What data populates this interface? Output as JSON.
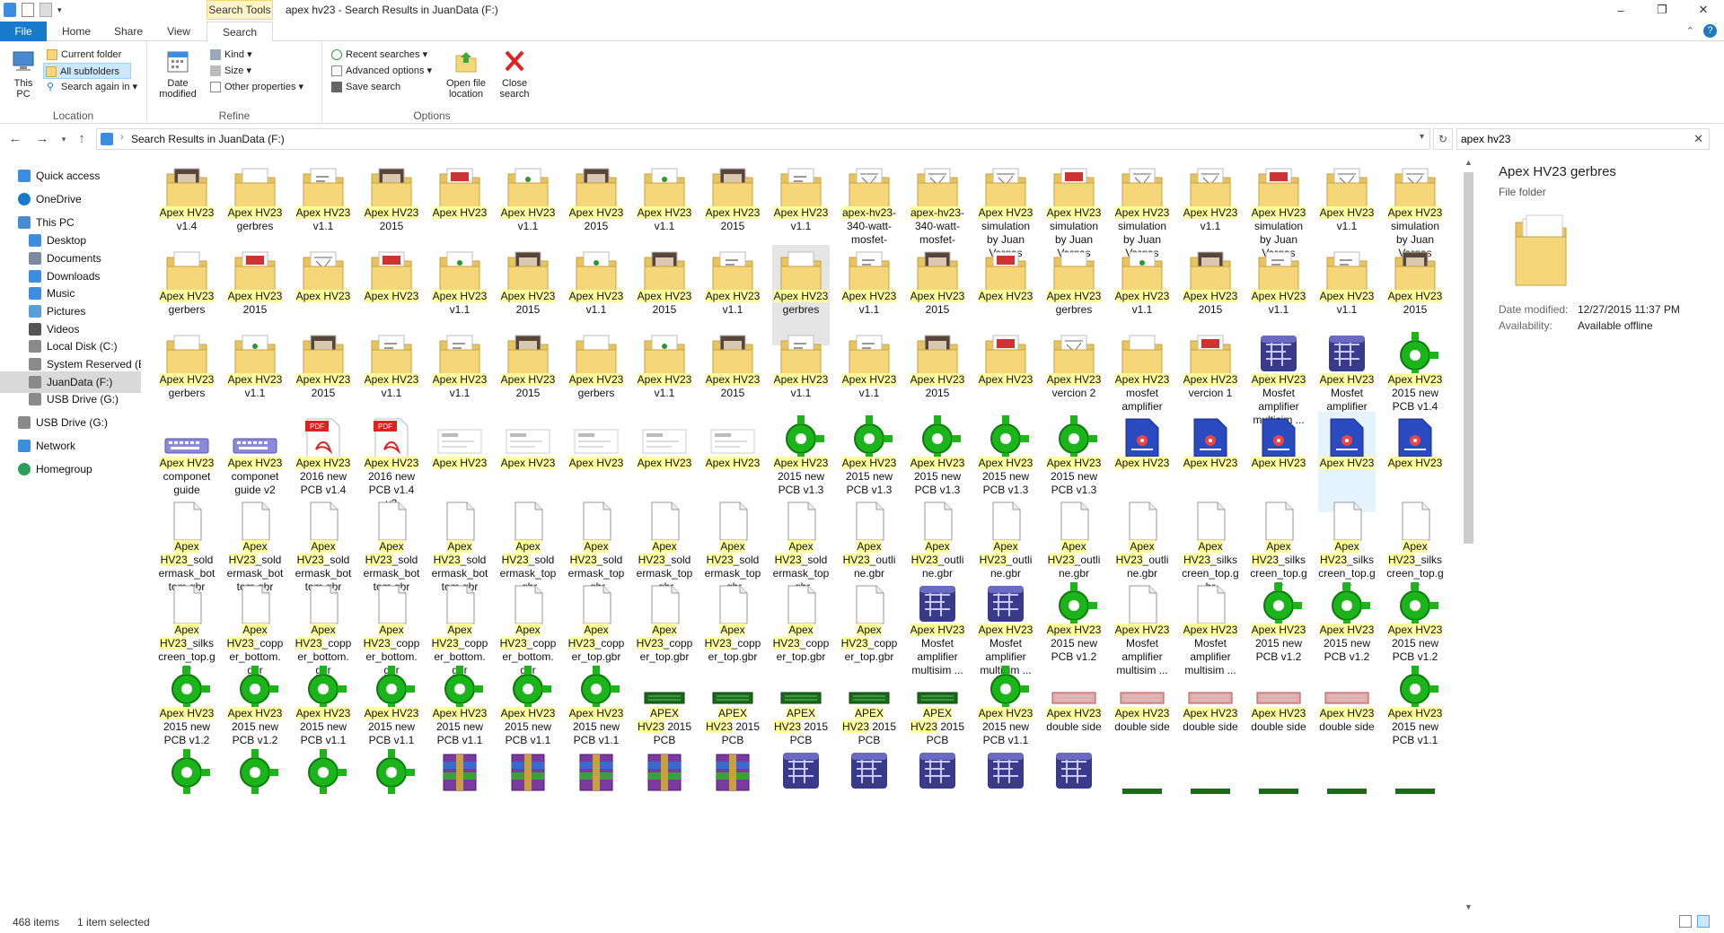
{
  "window": {
    "title": "apex hv23 - Search Results in JuanData (F:)",
    "search_tools_label": "Search Tools"
  },
  "tabs": {
    "file": "File",
    "home": "Home",
    "share": "Share",
    "view": "View",
    "search": "Search"
  },
  "ribbon": {
    "location": {
      "label": "Location",
      "this_pc": "This PC",
      "current_folder": "Current folder",
      "all_subfolders": "All subfolders",
      "search_again": "Search again in"
    },
    "refine": {
      "label": "Refine",
      "date_modified": "Date modified",
      "kind": "Kind",
      "size": "Size",
      "other_properties": "Other properties"
    },
    "options": {
      "label": "Options",
      "recent_searches": "Recent searches",
      "advanced_options": "Advanced options",
      "save_search": "Save search",
      "open_file_location": "Open file location",
      "close_search": "Close search"
    }
  },
  "address": {
    "path": "Search Results in JuanData (F:)"
  },
  "search": {
    "value": "apex hv23"
  },
  "nav": [
    {
      "label": "Quick access",
      "icon": "star-icon",
      "color": "#3d8ee0",
      "indent": 20
    },
    {
      "label": "OneDrive",
      "icon": "cloud-icon",
      "color": "#1979ca",
      "indent": 20
    },
    {
      "label": "This PC",
      "icon": "computer-icon",
      "color": "#4a8ad0",
      "indent": 20
    },
    {
      "label": "Desktop",
      "icon": "desktop-icon",
      "color": "#3d8ee0",
      "indent": 32
    },
    {
      "label": "Documents",
      "icon": "documents-icon",
      "color": "#7a8aa0",
      "indent": 32
    },
    {
      "label": "Downloads",
      "icon": "download-icon",
      "color": "#3d8ee0",
      "indent": 32
    },
    {
      "label": "Music",
      "icon": "music-icon",
      "color": "#3d8ee0",
      "indent": 32
    },
    {
      "label": "Pictures",
      "icon": "pictures-icon",
      "color": "#5aa0d8",
      "indent": 32
    },
    {
      "label": "Videos",
      "icon": "videos-icon",
      "color": "#555555",
      "indent": 32
    },
    {
      "label": "Local Disk (C:)",
      "icon": "drive-icon",
      "color": "#8a8a8a",
      "indent": 32
    },
    {
      "label": "System Reserved (E:",
      "icon": "drive-icon",
      "color": "#8a8a8a",
      "indent": 32
    },
    {
      "label": "JuanData (F:)",
      "icon": "drive-icon",
      "color": "#8a8a8a",
      "indent": 32
    },
    {
      "label": "USB Drive (G:)",
      "icon": "usb-drive-icon",
      "color": "#8a8a8a",
      "indent": 32
    },
    {
      "label": "USB Drive (G:)",
      "icon": "usb-drive-icon",
      "color": "#8a8a8a",
      "indent": 20
    },
    {
      "label": "Network",
      "icon": "network-icon",
      "color": "#3d8ee0",
      "indent": 20
    },
    {
      "label": "Homegroup",
      "icon": "homegroup-icon",
      "color": "#2aa05a",
      "indent": 20
    }
  ],
  "items": [
    [
      {
        "icon": "folder-dark",
        "hl": "Apex HV23",
        "rest": " v1.4"
      },
      {
        "icon": "folder",
        "hl": "Apex HV23",
        "rest": " gerbres"
      },
      {
        "icon": "folder-doc",
        "hl": "Apex HV23",
        "rest": " v1.1"
      },
      {
        "icon": "folder-dark",
        "hl": "Apex HV23",
        "rest": " 2015"
      },
      {
        "icon": "folder-pdf",
        "hl": "Apex HV23",
        "rest": ""
      },
      {
        "icon": "folder-green",
        "hl": "Apex HV23",
        "rest": " v1.1"
      },
      {
        "icon": "folder-dark",
        "hl": "Apex HV23",
        "rest": " 2015"
      },
      {
        "icon": "folder-green",
        "hl": "Apex HV23",
        "rest": " v1.1"
      },
      {
        "icon": "folder-dark",
        "hl": "Apex HV23",
        "rest": " 2015"
      },
      {
        "icon": "folder-doc",
        "hl": "Apex HV23",
        "rest": " v1.1"
      },
      {
        "icon": "folder-sketch",
        "hl": "apex-hv23",
        "rest": "-340-watt-mosfet-"
      },
      {
        "icon": "folder-sketch",
        "hl": "apex-hv23",
        "rest": "-340-watt-mosfet-"
      },
      {
        "icon": "folder-sketch",
        "hl": "Apex HV23",
        "rest": " simulation by Juan Vargas Diaz"
      },
      {
        "icon": "folder-pdf",
        "hl": "Apex HV23",
        "rest": " simulation by Juan Vargas Diaz"
      },
      {
        "icon": "folder-sketch",
        "hl": "Apex HV23",
        "rest": " simulation by Juan Vargas Diaz"
      },
      {
        "icon": "folder-sketch",
        "hl": "Apex HV23",
        "rest": " v1.1"
      },
      {
        "icon": "folder-pdf",
        "hl": "Apex HV23",
        "rest": " simulation by Juan Vargas Diaz"
      },
      {
        "icon": "folder-sketch",
        "hl": "Apex HV23",
        "rest": " v1.1"
      },
      {
        "icon": "folder-sketch",
        "hl": "Apex HV23",
        "rest": " simulation by Juan Vargas Diaz"
      }
    ],
    [
      {
        "icon": "folder",
        "hl": "Apex HV23",
        "rest": " gerbers"
      },
      {
        "icon": "folder-pdf",
        "hl": "Apex HV23",
        "rest": " 2015"
      },
      {
        "icon": "folder-sketch",
        "hl": "Apex HV23",
        "rest": ""
      },
      {
        "icon": "folder-pdf",
        "hl": "Apex HV23",
        "rest": ""
      },
      {
        "icon": "folder-green",
        "hl": "Apex HV23",
        "rest": " v1.1"
      },
      {
        "icon": "folder-dark",
        "hl": "Apex HV23",
        "rest": " 2015"
      },
      {
        "icon": "folder-green",
        "hl": "Apex HV23",
        "rest": " v1.1"
      },
      {
        "icon": "folder-dark",
        "hl": "Apex HV23",
        "rest": " 2015"
      },
      {
        "icon": "folder-doc",
        "hl": "Apex HV23",
        "rest": " v1.1"
      },
      {
        "icon": "folder",
        "hl": "Apex HV23",
        "rest": " gerbres",
        "state": "hover"
      },
      {
        "icon": "folder-doc",
        "hl": "Apex HV23",
        "rest": " v1.1"
      },
      {
        "icon": "folder-dark",
        "hl": "Apex HV23",
        "rest": " 2015"
      },
      {
        "icon": "folder-pdf",
        "hl": "Apex HV23",
        "rest": ""
      },
      {
        "icon": "folder",
        "hl": "Apex HV23",
        "rest": " gerbres"
      },
      {
        "icon": "folder-green",
        "hl": "Apex HV23",
        "rest": " v1.1"
      },
      {
        "icon": "folder-dark",
        "hl": "Apex HV23",
        "rest": " 2015"
      },
      {
        "icon": "folder-doc",
        "hl": "Apex HV23",
        "rest": " v1.1"
      },
      {
        "icon": "folder-doc",
        "hl": "Apex HV23",
        "rest": " v1.1"
      },
      {
        "icon": "folder-dark",
        "hl": "Apex HV23",
        "rest": " 2015"
      }
    ],
    [
      {
        "icon": "folder",
        "hl": "Apex HV23",
        "rest": " gerbers"
      },
      {
        "icon": "folder-green",
        "hl": "Apex HV23",
        "rest": " v1.1"
      },
      {
        "icon": "folder-dark",
        "hl": "Apex HV23",
        "rest": " 2015"
      },
      {
        "icon": "folder-doc",
        "hl": "Apex HV23",
        "rest": " v1.1"
      },
      {
        "icon": "folder-doc",
        "hl": "Apex HV23",
        "rest": " v1.1"
      },
      {
        "icon": "folder-dark",
        "hl": "Apex HV23",
        "rest": " 2015"
      },
      {
        "icon": "folder",
        "hl": "Apex HV23",
        "rest": " gerbers"
      },
      {
        "icon": "folder-green",
        "hl": "Apex HV23",
        "rest": " v1.1"
      },
      {
        "icon": "folder-dark",
        "hl": "Apex HV23",
        "rest": " 2015"
      },
      {
        "icon": "folder-doc",
        "hl": "Apex HV23",
        "rest": " v1.1"
      },
      {
        "icon": "folder-doc",
        "hl": "Apex HV23",
        "rest": " v1.1"
      },
      {
        "icon": "folder-dark",
        "hl": "Apex HV23",
        "rest": " 2015"
      },
      {
        "icon": "folder-pdf",
        "hl": "Apex HV23",
        "rest": ""
      },
      {
        "icon": "folder-sketch",
        "hl": "Apex HV23",
        "rest": " vercion 2"
      },
      {
        "icon": "folder",
        "hl": "Apex HV23",
        "rest": " mosfet amplifier"
      },
      {
        "icon": "folder-pdf",
        "hl": "Apex HV23",
        "rest": " vercion 1"
      },
      {
        "icon": "multisim",
        "hl": "Apex HV23",
        "rest": " Mosfet amplifier multisim ..."
      },
      {
        "icon": "multisim",
        "hl": "Apex HV23",
        "rest": " Mosfet amplifier multisim"
      },
      {
        "icon": "pcb-green",
        "hl": "Apex HV23",
        "rest": " 2015 new PCB v1.4"
      }
    ],
    [
      {
        "icon": "keyboard",
        "hl": "Apex HV23",
        "rest": " componet guide"
      },
      {
        "icon": "keyboard",
        "hl": "Apex HV23",
        "rest": " componet guide v2"
      },
      {
        "icon": "pdf",
        "hl": "Apex HV23",
        "rest": " 2016 new PCB v1.4"
      },
      {
        "icon": "pdf",
        "hl": "Apex HV23",
        "rest": " 2016 new PCB v1.4 v2"
      },
      {
        "icon": "image",
        "hl": "Apex HV23",
        "rest": ""
      },
      {
        "icon": "image",
        "hl": "Apex HV23",
        "rest": ""
      },
      {
        "icon": "image",
        "hl": "Apex HV23",
        "rest": ""
      },
      {
        "icon": "image",
        "hl": "Apex HV23",
        "rest": ""
      },
      {
        "icon": "image",
        "hl": "Apex HV23",
        "rest": ""
      },
      {
        "icon": "pcb-green",
        "hl": "Apex HV23",
        "rest": " 2015 new PCB v1.3"
      },
      {
        "icon": "pcb-green",
        "hl": "Apex HV23",
        "rest": " 2015 new PCB v1.3"
      },
      {
        "icon": "pcb-green",
        "hl": "Apex HV23",
        "rest": " 2015 new PCB v1.3"
      },
      {
        "icon": "pcb-green",
        "hl": "Apex HV23",
        "rest": " 2015 new PCB v1.3"
      },
      {
        "icon": "pcb-green",
        "hl": "Apex HV23",
        "rest": " 2015 new PCB v1.3"
      },
      {
        "icon": "multisim-doc",
        "hl": "Apex HV23",
        "rest": ""
      },
      {
        "icon": "multisim-doc",
        "hl": "Apex HV23",
        "rest": ""
      },
      {
        "icon": "multisim-doc",
        "hl": "Apex HV23",
        "rest": ""
      },
      {
        "icon": "multisim-doc",
        "hl": "Apex HV23",
        "rest": "",
        "state": "selected"
      },
      {
        "icon": "multisim-doc",
        "hl": "Apex HV23",
        "rest": ""
      }
    ],
    [
      {
        "icon": "blank",
        "hl": "Apex HV23",
        "rest": "_soldermask_bottom.gbr"
      },
      {
        "icon": "blank",
        "hl": "Apex HV23",
        "rest": "_soldermask_bottom.gbr"
      },
      {
        "icon": "blank",
        "hl": "Apex HV23",
        "rest": "_soldermask_bottom.gbr"
      },
      {
        "icon": "blank",
        "hl": "Apex HV23",
        "rest": "_soldermask_bottom.gbr"
      },
      {
        "icon": "blank",
        "hl": "Apex HV23",
        "rest": "_soldermask_bottom.gbr"
      },
      {
        "icon": "blank",
        "hl": "Apex HV23",
        "rest": "_soldermask_top.gbr"
      },
      {
        "icon": "blank",
        "hl": "Apex HV23",
        "rest": "_soldermask_top.gbr"
      },
      {
        "icon": "blank",
        "hl": "Apex HV23",
        "rest": "_soldermask_top.gbr"
      },
      {
        "icon": "blank",
        "hl": "Apex HV23",
        "rest": "_soldermask_top.gbr"
      },
      {
        "icon": "blank",
        "hl": "Apex HV23",
        "rest": "_soldermask_top.gbr"
      },
      {
        "icon": "blank",
        "hl": "Apex HV23",
        "rest": "_outline.gbr"
      },
      {
        "icon": "blank",
        "hl": "Apex HV23",
        "rest": "_outline.gbr"
      },
      {
        "icon": "blank",
        "hl": "Apex HV23",
        "rest": "_outline.gbr"
      },
      {
        "icon": "blank",
        "hl": "Apex HV23",
        "rest": "_outline.gbr"
      },
      {
        "icon": "blank",
        "hl": "Apex HV23",
        "rest": "_outline.gbr"
      },
      {
        "icon": "blank",
        "hl": "Apex HV23",
        "rest": "_silkscreen_top.gbr"
      },
      {
        "icon": "blank",
        "hl": "Apex HV23",
        "rest": "_silkscreen_top.gbr"
      },
      {
        "icon": "blank",
        "hl": "Apex HV23",
        "rest": "_silkscreen_top.gbr"
      },
      {
        "icon": "blank",
        "hl": "Apex HV23",
        "rest": "_silkscreen_top.gbr"
      }
    ],
    [
      {
        "icon": "blank",
        "hl": "Apex HV23",
        "rest": "_silkscreen_top.gbr"
      },
      {
        "icon": "blank",
        "hl": "Apex HV23",
        "rest": "_copper_bottom.gbr"
      },
      {
        "icon": "blank",
        "hl": "Apex HV23",
        "rest": "_copper_bottom.gbr"
      },
      {
        "icon": "blank",
        "hl": "Apex HV23",
        "rest": "_copper_bottom.gbr"
      },
      {
        "icon": "blank",
        "hl": "Apex HV23",
        "rest": "_copper_bottom.gbr"
      },
      {
        "icon": "blank",
        "hl": "Apex HV23",
        "rest": "_copper_bottom.gbr"
      },
      {
        "icon": "blank",
        "hl": "Apex HV23",
        "rest": "_copper_top.gbr"
      },
      {
        "icon": "blank",
        "hl": "Apex HV23",
        "rest": "_copper_top.gbr"
      },
      {
        "icon": "blank",
        "hl": "Apex HV23",
        "rest": "_copper_top.gbr"
      },
      {
        "icon": "blank",
        "hl": "Apex HV23",
        "rest": "_copper_top.gbr"
      },
      {
        "icon": "blank",
        "hl": "Apex HV23",
        "rest": "_copper_top.gbr"
      },
      {
        "icon": "multisim",
        "hl": "Apex HV23",
        "rest": " Mosfet amplifier multisim ..."
      },
      {
        "icon": "multisim",
        "hl": "Apex HV23",
        "rest": " Mosfet amplifier multisim ..."
      },
      {
        "icon": "pcb-green",
        "hl": "Apex HV23",
        "rest": " 2015 new PCB v1.2"
      },
      {
        "icon": "blank",
        "hl": "Apex HV23",
        "rest": " Mosfet amplifier multisim ..."
      },
      {
        "icon": "blank",
        "hl": "Apex HV23",
        "rest": " Mosfet amplifier multisim ..."
      },
      {
        "icon": "pcb-green",
        "hl": "Apex HV23",
        "rest": " 2015 new PCB v1.2"
      },
      {
        "icon": "pcb-green",
        "hl": "Apex HV23",
        "rest": " 2015 new PCB v1.2"
      },
      {
        "icon": "pcb-green",
        "hl": "Apex HV23",
        "rest": " 2015 new PCB v1.2"
      }
    ],
    [
      {
        "icon": "pcb-green",
        "hl": "Apex HV23",
        "rest": " 2015 new PCB v1.2"
      },
      {
        "icon": "pcb-green",
        "hl": "Apex HV23",
        "rest": " 2015 new PCB v1.2"
      },
      {
        "icon": "pcb-green",
        "hl": "Apex HV23",
        "rest": " 2015 new PCB v1.1"
      },
      {
        "icon": "pcb-green",
        "hl": "Apex HV23",
        "rest": " 2015 new PCB v1.1"
      },
      {
        "icon": "pcb-green",
        "hl": "Apex HV23",
        "rest": " 2015 new PCB v1.1"
      },
      {
        "icon": "pcb-green",
        "hl": "Apex HV23",
        "rest": " 2015 new PCB v1.1"
      },
      {
        "icon": "pcb-green",
        "hl": "Apex HV23",
        "rest": " 2015 new PCB v1.1"
      },
      {
        "icon": "pcb-board",
        "hl": "APEX HV23",
        "rest": " 2015 PCB"
      },
      {
        "icon": "pcb-board",
        "hl": "APEX HV23",
        "rest": " 2015 PCB"
      },
      {
        "icon": "pcb-board",
        "hl": "APEX HV23",
        "rest": " 2015 PCB"
      },
      {
        "icon": "pcb-board",
        "hl": "APEX HV23",
        "rest": " 2015 PCB"
      },
      {
        "icon": "pcb-board",
        "hl": "APEX HV23",
        "rest": " 2015 PCB"
      },
      {
        "icon": "pcb-green",
        "hl": "Apex HV23",
        "rest": " 2015 new PCB v1.1"
      },
      {
        "icon": "pcb-double",
        "hl": "Apex HV23",
        "rest": " double side"
      },
      {
        "icon": "pcb-double",
        "hl": "Apex HV23",
        "rest": " double side"
      },
      {
        "icon": "pcb-double",
        "hl": "Apex HV23",
        "rest": " double side"
      },
      {
        "icon": "pcb-double",
        "hl": "Apex HV23",
        "rest": " double side"
      },
      {
        "icon": "pcb-double",
        "hl": "Apex HV23",
        "rest": " double side"
      },
      {
        "icon": "pcb-green",
        "hl": "Apex HV23",
        "rest": " 2015 new PCB v1.1"
      }
    ],
    [
      {
        "icon": "pcb-green"
      },
      {
        "icon": "pcb-green"
      },
      {
        "icon": "pcb-green"
      },
      {
        "icon": "pcb-green"
      },
      {
        "icon": "archive"
      },
      {
        "icon": "archive"
      },
      {
        "icon": "archive"
      },
      {
        "icon": "archive"
      },
      {
        "icon": "archive"
      },
      {
        "icon": "multisim"
      },
      {
        "icon": "multisim"
      },
      {
        "icon": "multisim"
      },
      {
        "icon": "multisim"
      },
      {
        "icon": "multisim"
      },
      {
        "icon": "pcb-strip"
      },
      {
        "icon": "pcb-strip"
      },
      {
        "icon": "pcb-strip"
      },
      {
        "icon": "pcb-strip"
      },
      {
        "icon": "pcb-strip"
      }
    ]
  ],
  "preview": {
    "title": "Apex HV23 gerbres",
    "type": "File folder",
    "date_modified_label": "Date modified:",
    "date_modified_value": "12/27/2015 11:37 PM",
    "availability_label": "Availability:",
    "availability_value": "Available offline"
  },
  "status": {
    "count": "468 items",
    "selected": "1 item selected"
  },
  "colors": {
    "accent": "#1979ca",
    "highlight": "#ffff9e",
    "selected": "#e5f3ff",
    "hover": "#e5e5e5"
  }
}
